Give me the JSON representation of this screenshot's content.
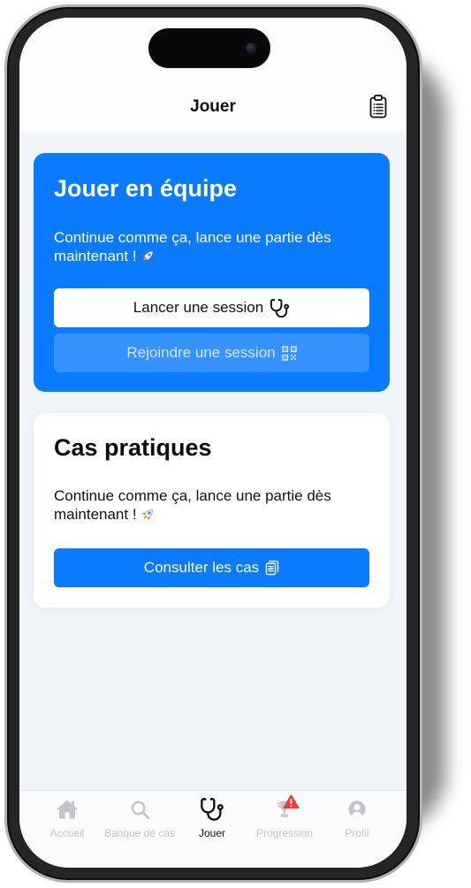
{
  "header": {
    "title": "Jouer",
    "action_icon": "clipboard-list-icon"
  },
  "team_card": {
    "title": "Jouer en équipe",
    "text": "Continue comme ça, lance une partie dès maintenant !",
    "text_icon": "rocket-icon",
    "primary_button": {
      "label": "Lancer une session",
      "icon": "stethoscope-icon"
    },
    "secondary_button": {
      "label": "Rejoindre une session",
      "icon": "qr-code-icon"
    }
  },
  "cases_card": {
    "title": "Cas pratiques",
    "text": "Continue comme ça, lance une partie dès maintenant !",
    "text_icon": "rocket-icon",
    "button": {
      "label": "Consulter les cas",
      "icon": "document-icon"
    }
  },
  "tab_bar": {
    "items": [
      {
        "label": "Accueil",
        "icon": "home-icon",
        "active": false
      },
      {
        "label": "Banque de cas",
        "icon": "search-icon",
        "active": false
      },
      {
        "label": "Jouer",
        "icon": "stethoscope-icon",
        "active": true
      },
      {
        "label": "Progression",
        "icon": "trophy-icon",
        "active": false,
        "badge_icon": "warning-icon"
      },
      {
        "label": "Profil",
        "icon": "profile-icon",
        "active": false
      }
    ]
  },
  "colors": {
    "accent": "#0a7bfe",
    "screen_background": "#f1f5fa",
    "card_background": "#ffffff",
    "tab_inactive": "#c2c6cc",
    "tab_active": "#111111",
    "badge": "#ee3a3a"
  }
}
